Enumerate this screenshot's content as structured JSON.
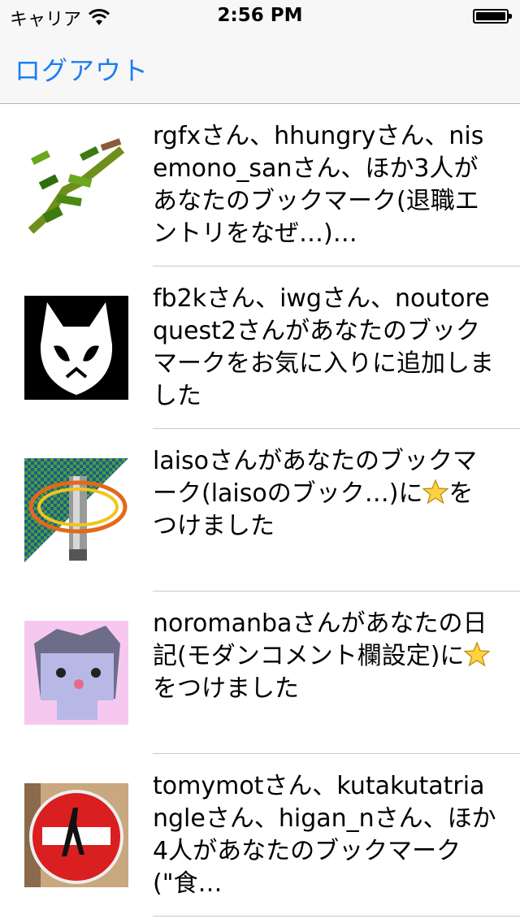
{
  "status": {
    "carrier": "キャリア",
    "time": "2:56 PM"
  },
  "nav": {
    "logout_label": "ログアウト"
  },
  "notifications": [
    {
      "avatar": "green-vine-avatar",
      "text": "rgfxさん、hhungryさん、nisemono_sanさん、ほか3人があなたのブックマーク(退職エントリをなぜ…)…"
    },
    {
      "avatar": "white-cat-mask-avatar",
      "text": "fb2kさん、iwgさん、noutorequest2さんがあなたのブックマークをお気に入りに追加しました"
    },
    {
      "avatar": "pixel-pole-avatar",
      "text_before": "laisoさんがあなたのブックマーク(laisoのブック…)に",
      "star": "star-icon",
      "text_after": "をつけました"
    },
    {
      "avatar": "pixel-cat-avatar",
      "text_before": "noromanbaさんがあなたの日記(モダンコメント欄設定)に",
      "star": "star-icon",
      "text_after": "をつけました"
    },
    {
      "avatar": "no-entry-sign-avatar",
      "text": "tomymotさん、kutakutatriangleさん、higan_nさん、ほか4人があなたのブックマーク(\"食…"
    }
  ]
}
